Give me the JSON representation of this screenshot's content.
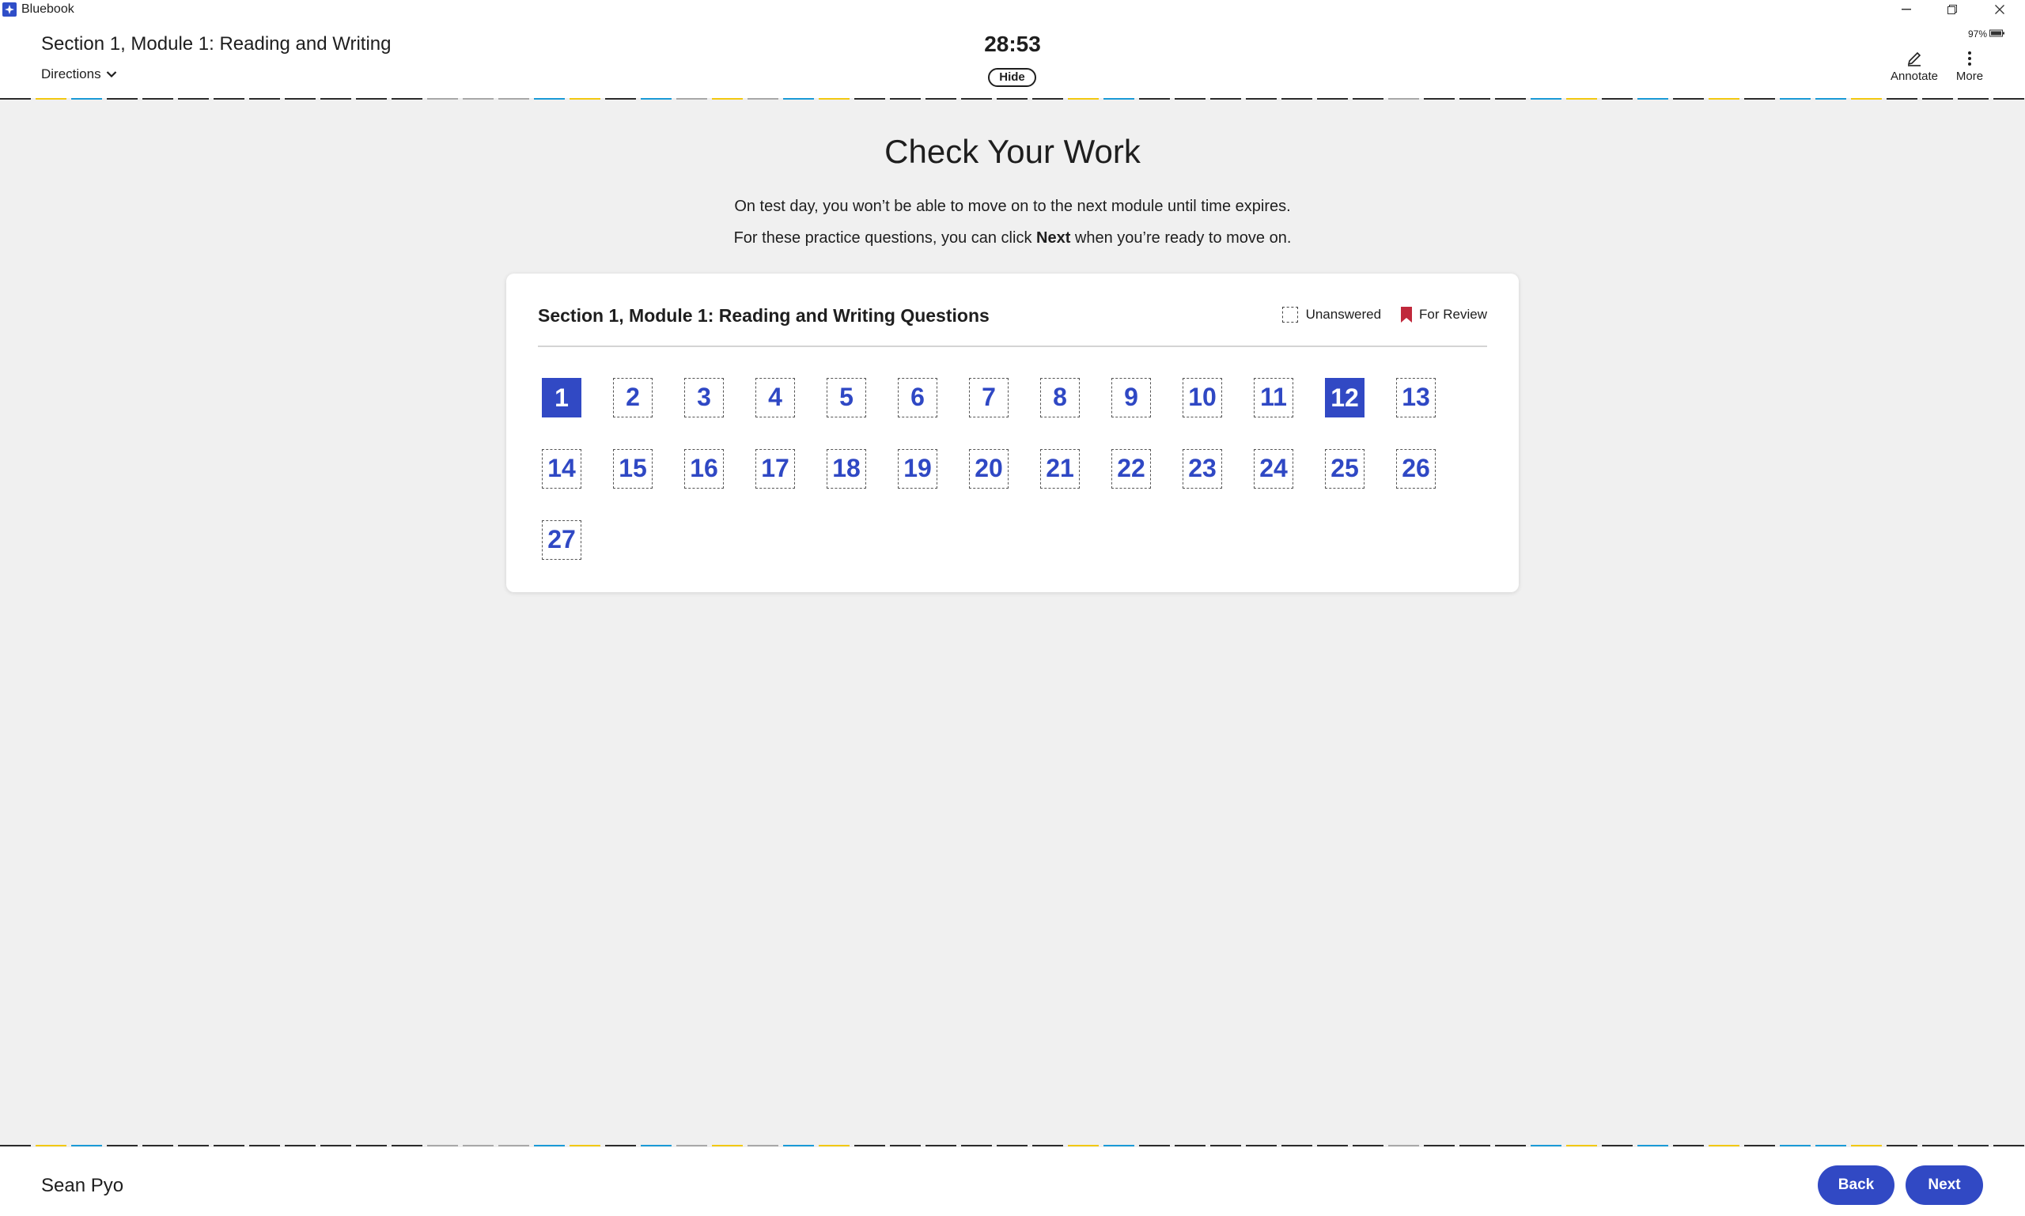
{
  "window": {
    "app_title": "Bluebook",
    "battery_text": "97%"
  },
  "header": {
    "section_title": "Section 1, Module 1: Reading and Writing",
    "directions_label": "Directions",
    "timer": "28:53",
    "hide_label": "Hide",
    "annotate_label": "Annotate",
    "more_label": "More"
  },
  "main": {
    "heading": "Check Your Work",
    "line1": "On test day, you won’t be able to move on to the next module until time expires.",
    "line2_pre": "For these practice questions, you can click ",
    "line2_bold": "Next",
    "line2_post": " when you’re ready to move on."
  },
  "card": {
    "title": "Section 1, Module 1: Reading and Writing Questions",
    "legend_unanswered": "Unanswered",
    "legend_review": "For Review",
    "questions": [
      "1",
      "2",
      "3",
      "4",
      "5",
      "6",
      "7",
      "8",
      "9",
      "10",
      "11",
      "12",
      "13",
      "14",
      "15",
      "16",
      "17",
      "18",
      "19",
      "20",
      "21",
      "22",
      "23",
      "24",
      "25",
      "26",
      "27"
    ],
    "current": [
      "1",
      "12"
    ]
  },
  "footer": {
    "user_name": "Sean Pyo",
    "back_label": "Back",
    "next_label": "Next"
  },
  "colors": {
    "accent": "#3149c4",
    "review_flag": "#c0283b",
    "dash_yellow": "#f2c811",
    "dash_blue": "#1a9ad6",
    "dash_dark": "#2b2b2b",
    "dash_gray": "#a8a8a8"
  }
}
